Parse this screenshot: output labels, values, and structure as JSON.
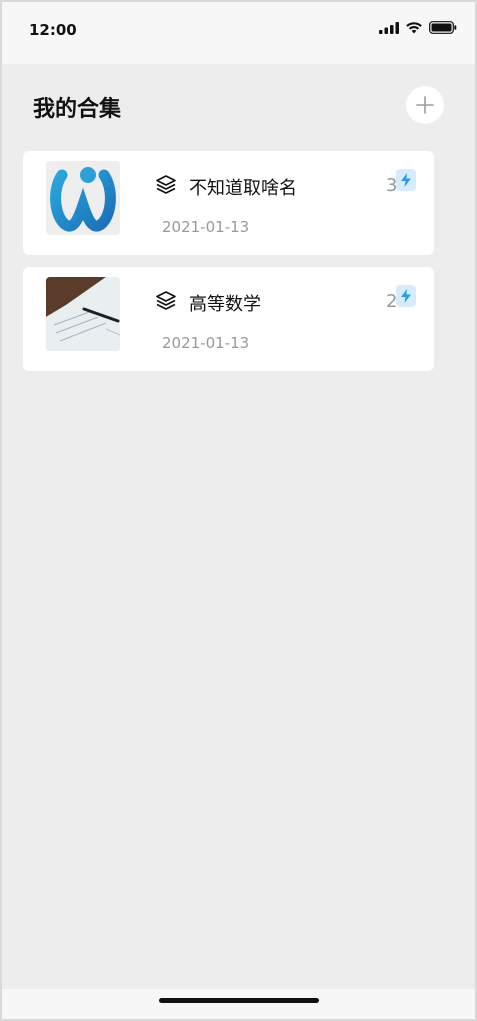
{
  "status_bar": {
    "time": "12:00"
  },
  "header": {
    "title": "我的合集"
  },
  "collections": [
    {
      "title": "不知道取啥名",
      "date": "2021-01-13",
      "count": "3",
      "thumbnail_icon": "app-logo-icon"
    },
    {
      "title": "高等数学",
      "date": "2021-01-13",
      "count": "2",
      "thumbnail_icon": "paper-pen-photo"
    }
  ],
  "colors": {
    "background": "#ededed",
    "card": "#ffffff",
    "accent": "#2b9ce8",
    "muted_text": "#999999"
  }
}
